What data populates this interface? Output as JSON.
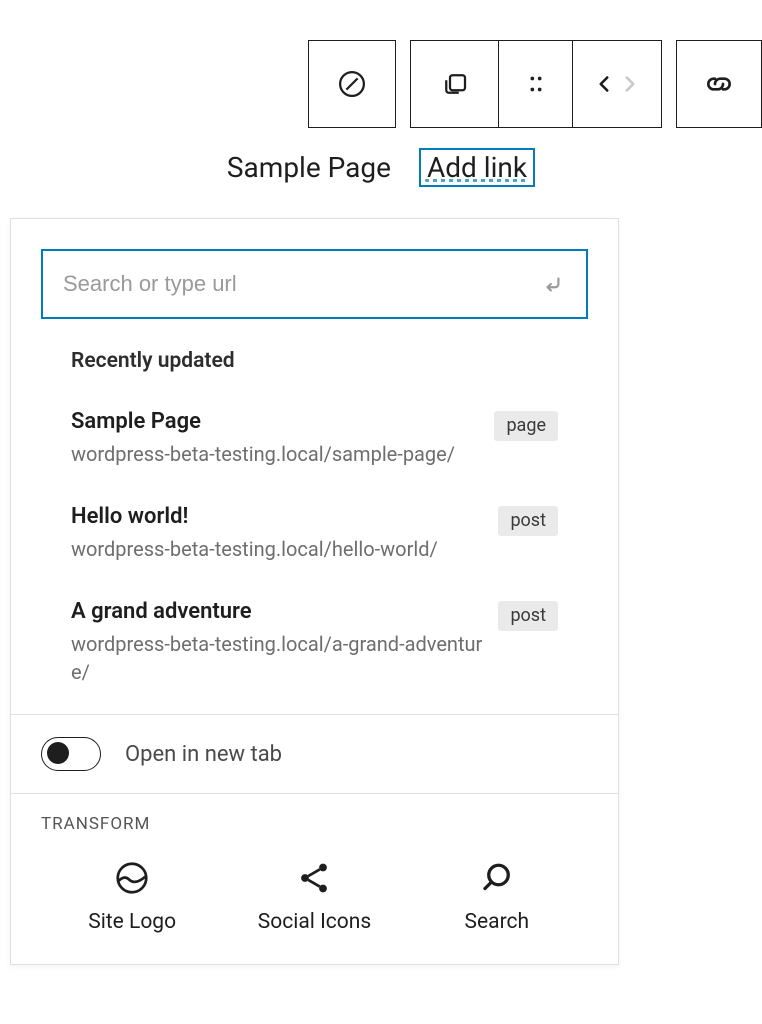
{
  "nav": {
    "item1": "Sample Page",
    "item2": "Add link"
  },
  "linkPanel": {
    "search": {
      "placeholder": "Search or type url",
      "value": ""
    },
    "recentLabel": "Recently updated",
    "results": [
      {
        "title": "Sample Page",
        "url": "wordpress-beta-testing.local/sample-page/",
        "type": "page"
      },
      {
        "title": "Hello world!",
        "url": "wordpress-beta-testing.local/hello-world/",
        "type": "post"
      },
      {
        "title": "A grand adventure",
        "url": "wordpress-beta-testing.local/a-grand-adventure/",
        "type": "post"
      }
    ],
    "openInNewTab": {
      "label": "Open in new tab",
      "value": false
    }
  },
  "transform": {
    "heading": "Transform",
    "items": [
      {
        "label": "Site Logo"
      },
      {
        "label": "Social Icons"
      },
      {
        "label": "Search"
      }
    ]
  },
  "colors": {
    "accent": "#007cba"
  }
}
